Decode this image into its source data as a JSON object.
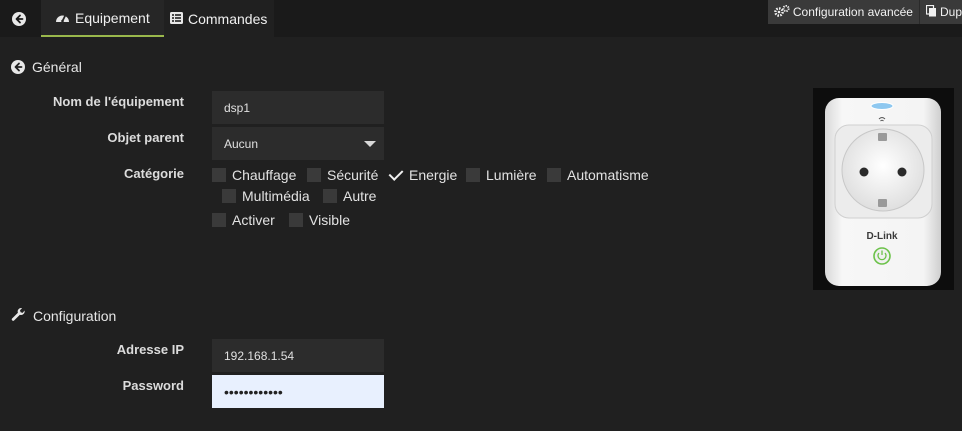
{
  "tabs": {
    "equipement": "Equipement",
    "commandes": "Commandes"
  },
  "toolbar": {
    "config_avancee": "Configuration avancée",
    "dupliquer": "Dup"
  },
  "general": {
    "title": "Général",
    "nom_label": "Nom de l'équipement",
    "nom_value": "dsp1",
    "objet_label": "Objet parent",
    "objet_value": "Aucun",
    "categorie_label": "Catégorie",
    "categories": [
      {
        "label": "Chauffage",
        "checked": false
      },
      {
        "label": "Sécurité",
        "checked": false
      },
      {
        "label": "Energie",
        "checked": true
      },
      {
        "label": "Lumière",
        "checked": false
      },
      {
        "label": "Automatisme",
        "checked": false
      },
      {
        "label": "Multimédia",
        "checked": false
      },
      {
        "label": "Autre",
        "checked": false
      }
    ],
    "activer": {
      "label": "Activer",
      "checked": false
    },
    "visible": {
      "label": "Visible",
      "checked": false
    }
  },
  "device_image": {
    "brand": "D-Link"
  },
  "configuration": {
    "title": "Configuration",
    "ip_label": "Adresse IP",
    "ip_value": "192.168.1.54",
    "password_label": "Password",
    "password_value": "••••••••••••"
  },
  "colors": {
    "accent": "#9ab84c",
    "background": "#202020",
    "power_led": "#6cc24a"
  }
}
